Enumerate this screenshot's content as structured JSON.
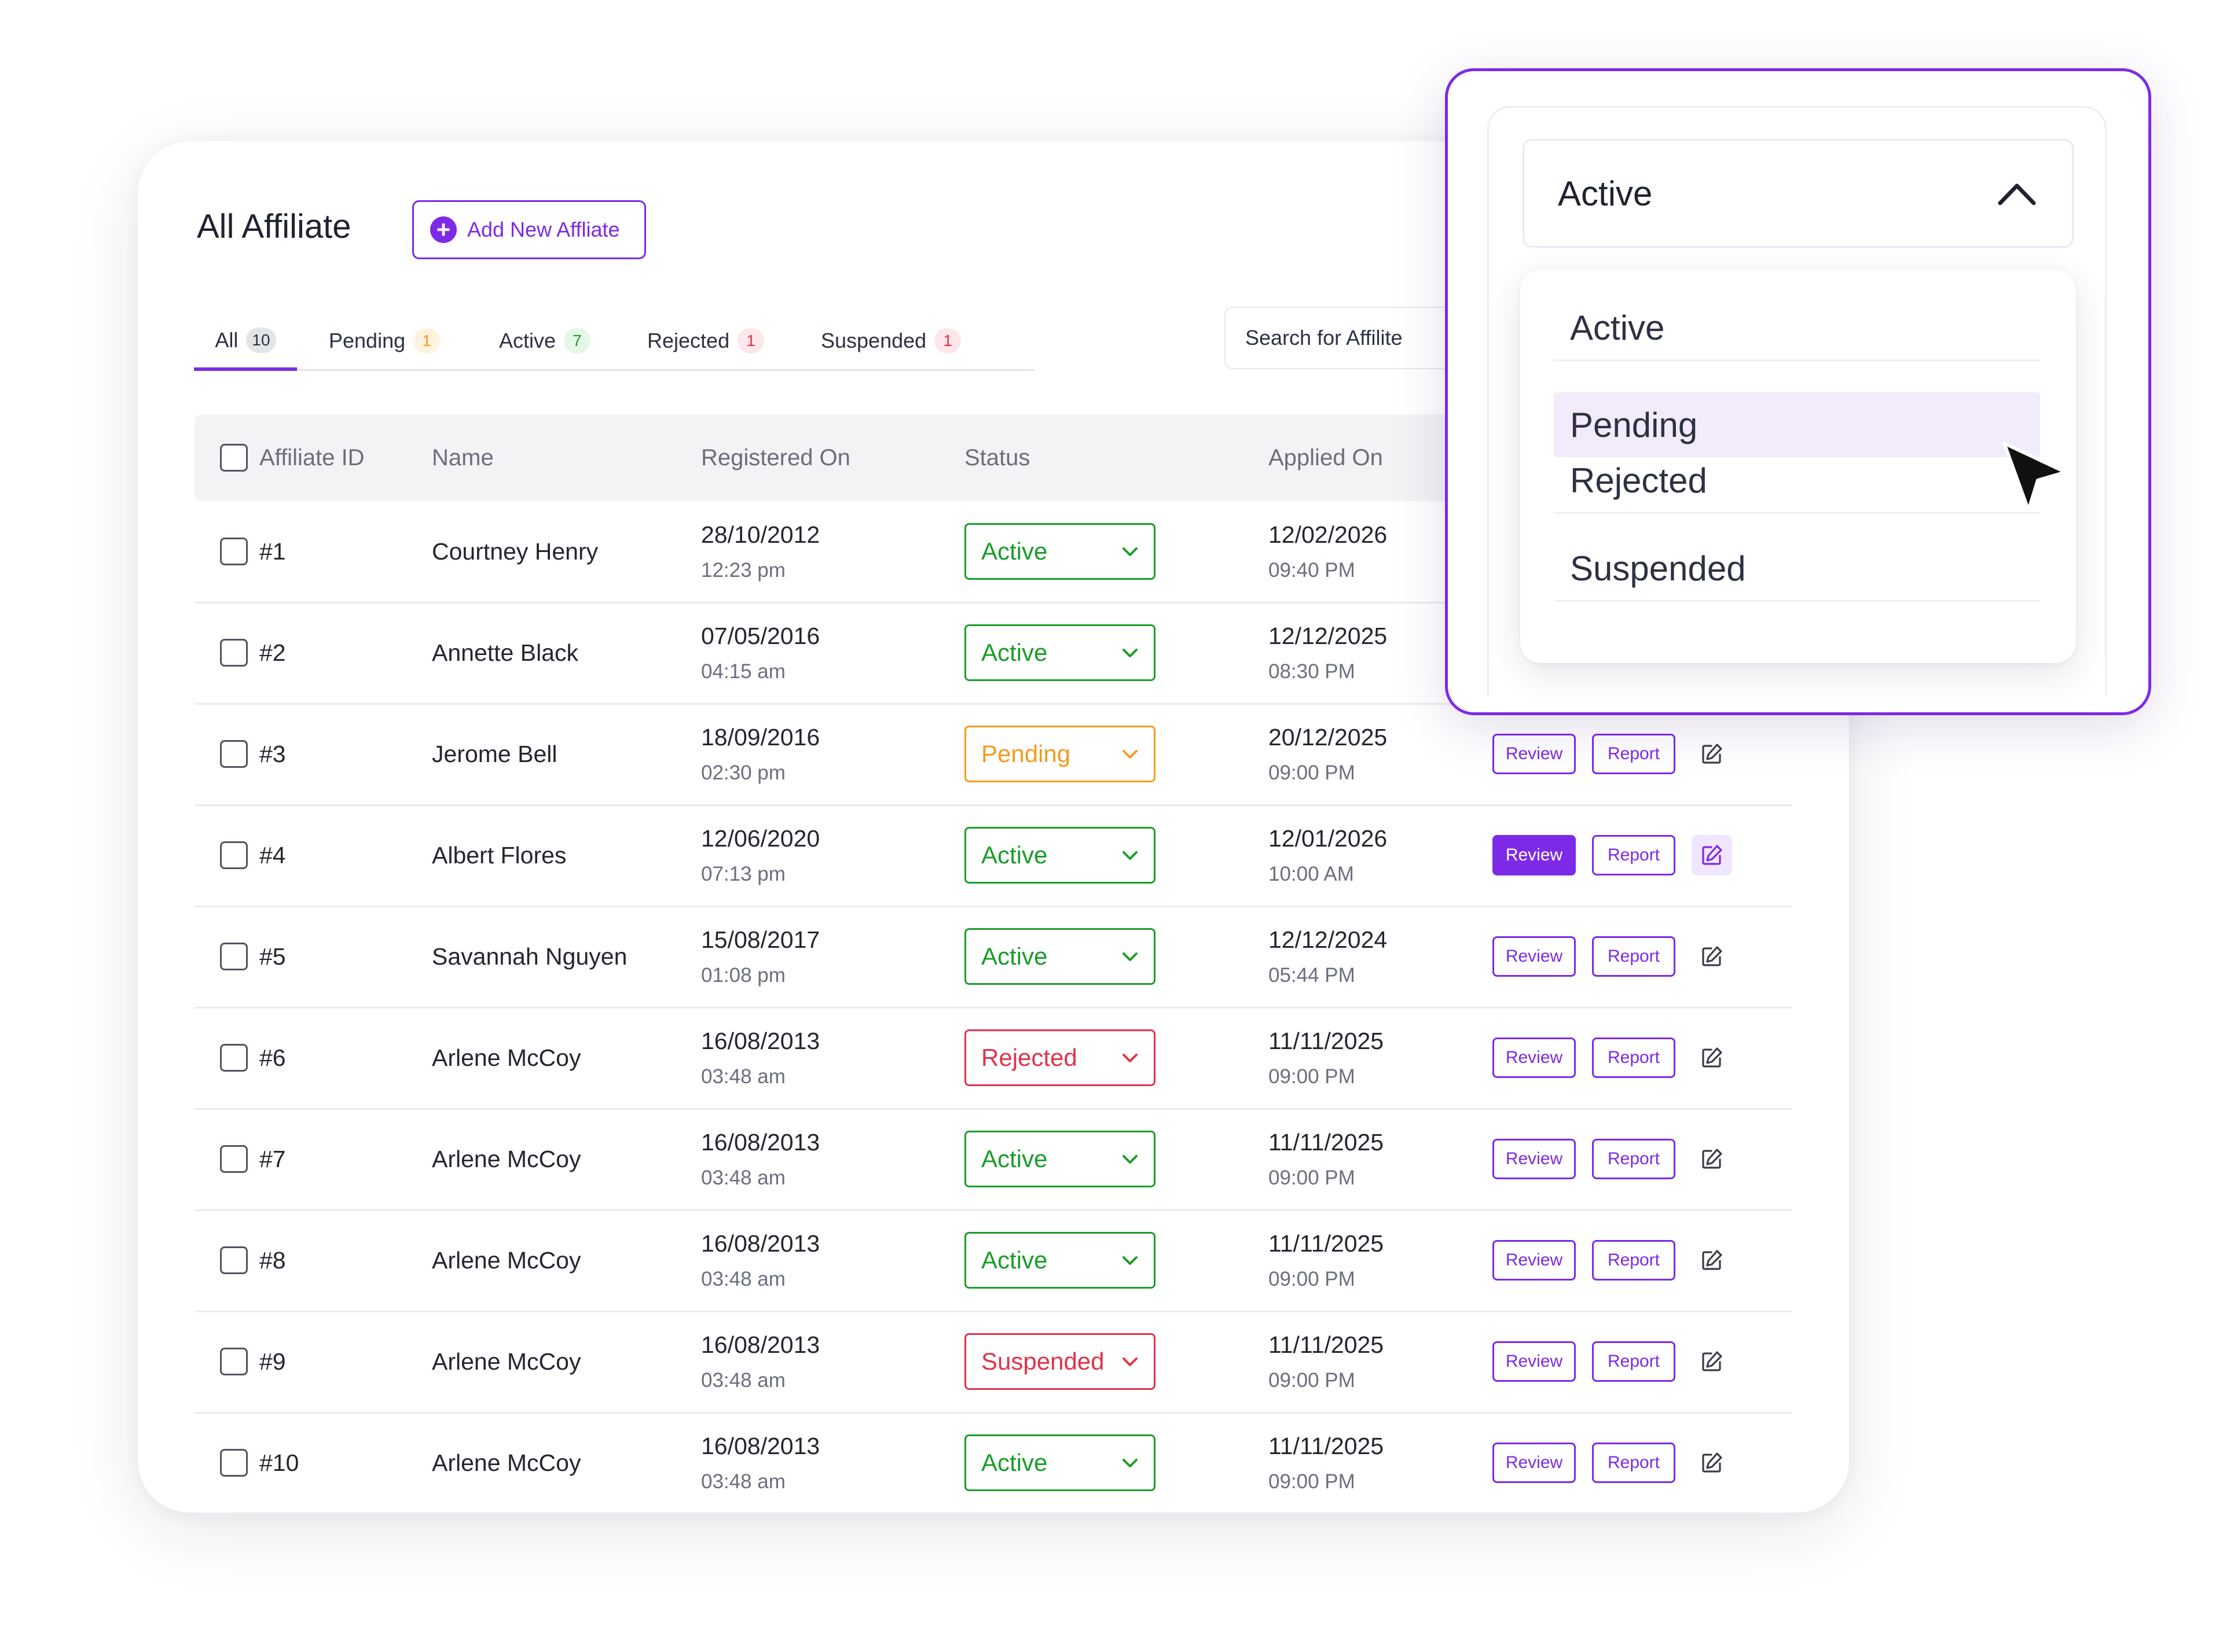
{
  "header": {
    "title": "All Affiliate",
    "add_button": "Add New Affliate",
    "search_placeholder": "Search for Affilite"
  },
  "tabs": [
    {
      "label": "All",
      "count": "10"
    },
    {
      "label": "Pending",
      "count": "1"
    },
    {
      "label": "Active",
      "count": "7"
    },
    {
      "label": "Rejected",
      "count": "1"
    },
    {
      "label": "Suspended",
      "count": "1"
    }
  ],
  "table": {
    "columns": [
      "Affiliate ID",
      "Name",
      "Registered On",
      "Status",
      "Applied On"
    ],
    "rows": [
      {
        "id": "#1",
        "name": "Courtney Henry",
        "reg_date": "28/10/2012",
        "reg_time": "12:23 pm",
        "status": "Active",
        "applied_date": "12/02/2026",
        "applied_time": "09:40 PM"
      },
      {
        "id": "#2",
        "name": "Annette Black",
        "reg_date": "07/05/2016",
        "reg_time": "04:15 am",
        "status": "Active",
        "applied_date": "12/12/2025",
        "applied_time": "08:30 PM"
      },
      {
        "id": "#3",
        "name": "Jerome Bell",
        "reg_date": "18/09/2016",
        "reg_time": "02:30 pm",
        "status": "Pending",
        "applied_date": "20/12/2025",
        "applied_time": "09:00 PM"
      },
      {
        "id": "#4",
        "name": "Albert Flores",
        "reg_date": "12/06/2020",
        "reg_time": "07:13 pm",
        "status": "Active",
        "applied_date": "12/01/2026",
        "applied_time": "10:00 AM"
      },
      {
        "id": "#5",
        "name": "Savannah Nguyen",
        "reg_date": "15/08/2017",
        "reg_time": "01:08 pm",
        "status": "Active",
        "applied_date": "12/12/2024",
        "applied_time": "05:44 PM"
      },
      {
        "id": "#6",
        "name": "Arlene McCoy",
        "reg_date": "16/08/2013",
        "reg_time": "03:48 am",
        "status": "Rejected",
        "applied_date": "11/11/2025",
        "applied_time": "09:00 PM"
      },
      {
        "id": "#7",
        "name": "Arlene McCoy",
        "reg_date": "16/08/2013",
        "reg_time": "03:48 am",
        "status": "Active",
        "applied_date": "11/11/2025",
        "applied_time": "09:00 PM"
      },
      {
        "id": "#8",
        "name": "Arlene McCoy",
        "reg_date": "16/08/2013",
        "reg_time": "03:48 am",
        "status": "Active",
        "applied_date": "11/11/2025",
        "applied_time": "09:00 PM"
      },
      {
        "id": "#9",
        "name": "Arlene McCoy",
        "reg_date": "16/08/2013",
        "reg_time": "03:48 am",
        "status": "Suspended",
        "applied_date": "11/11/2025",
        "applied_time": "09:00 PM"
      },
      {
        "id": "#10",
        "name": "Arlene McCoy",
        "reg_date": "16/08/2013",
        "reg_time": "03:48 am",
        "status": "Active",
        "applied_date": "11/11/2025",
        "applied_time": "09:00 PM"
      }
    ]
  },
  "actions": {
    "review": "Review",
    "report": "Report"
  },
  "dropdown": {
    "selected": "Active",
    "options": [
      "Active",
      "Pending",
      "Rejected",
      "Suspended"
    ],
    "hovered": "Pending"
  },
  "colors": {
    "accent": "#7c2ae8",
    "active": "#1a9c2a",
    "pending": "#f39c1e",
    "rejected": "#e0334a"
  },
  "icons": {
    "add": "plus-circle-icon",
    "chevron": "chevron-down-icon",
    "edit": "edit-icon",
    "cursor": "mouse-pointer-icon"
  }
}
